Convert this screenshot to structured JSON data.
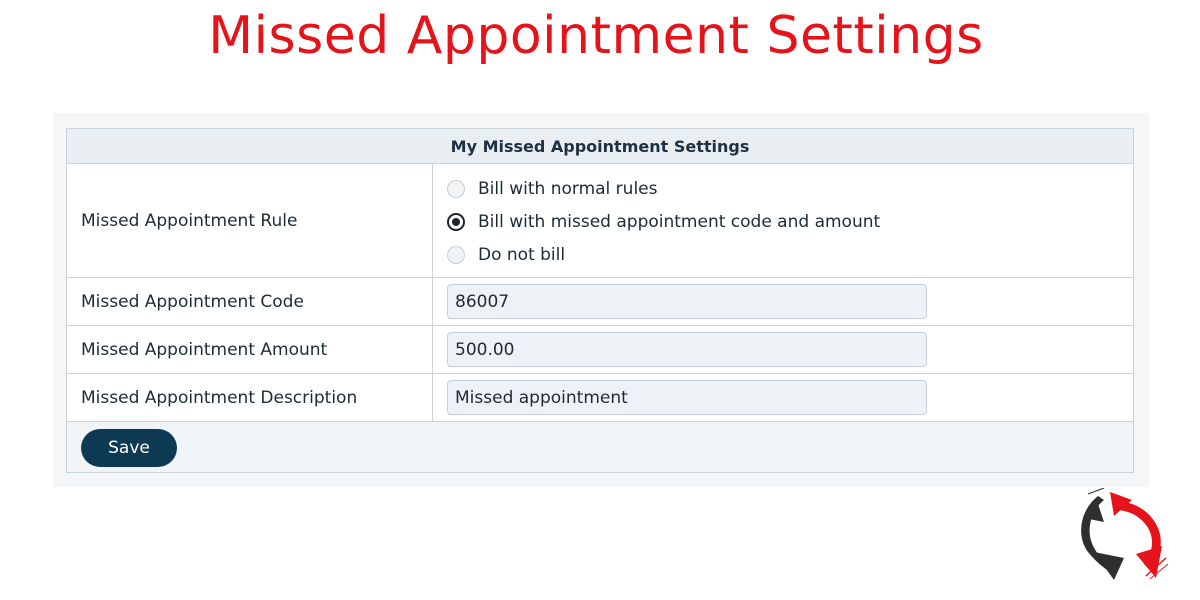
{
  "page": {
    "title": "Missed Appointment Settings"
  },
  "settings": {
    "header": "My Missed Appointment Settings",
    "rule": {
      "label": "Missed Appointment Rule",
      "options": [
        {
          "label": "Bill with normal rules",
          "selected": false
        },
        {
          "label": "Bill with missed appointment code and amount",
          "selected": true
        },
        {
          "label": "Do not bill",
          "selected": false
        }
      ]
    },
    "code": {
      "label": "Missed Appointment Code",
      "value": "86007"
    },
    "amount": {
      "label": "Missed Appointment Amount",
      "value": "500.00"
    },
    "description": {
      "label": "Missed Appointment Description",
      "value": "Missed appointment"
    },
    "save_label": "Save"
  },
  "logo": {
    "icon": "refresh-arrows-logo-icon",
    "colors": {
      "dark": "#2f2f2f",
      "accent": "#e5141b"
    }
  },
  "colors": {
    "title": "#e5141b",
    "button": "#0d3a52",
    "header_bg": "#e9eef3",
    "input_bg": "#eef2f6"
  }
}
